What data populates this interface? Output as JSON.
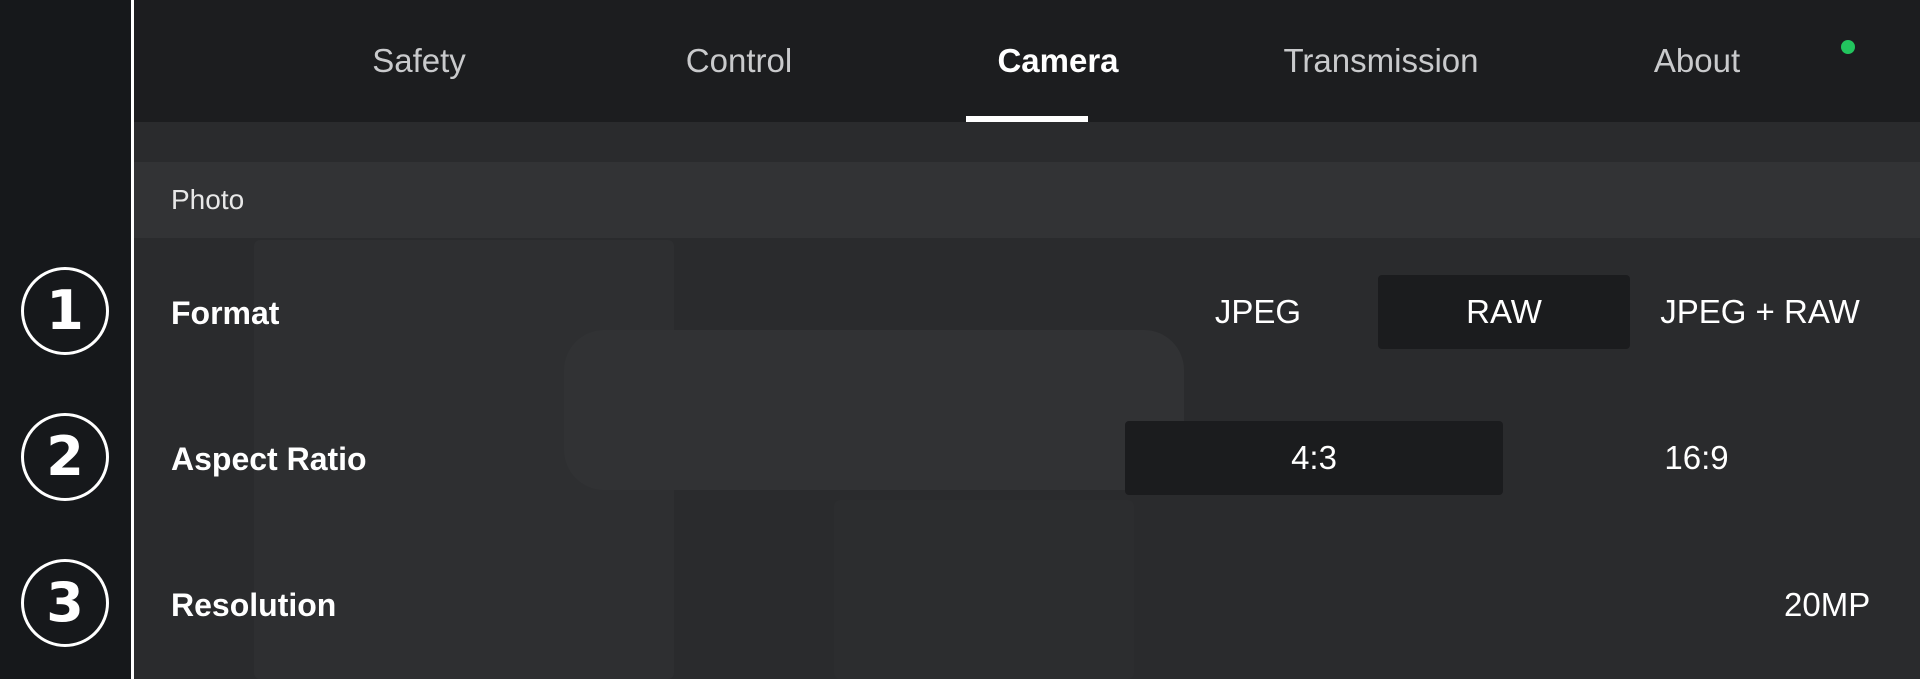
{
  "markers": [
    "1",
    "2",
    "3"
  ],
  "tabs": [
    {
      "label": "Safety",
      "active": false
    },
    {
      "label": "Control",
      "active": false
    },
    {
      "label": "Camera",
      "active": true
    },
    {
      "label": "Transmission",
      "active": false
    },
    {
      "label": "About",
      "active": false
    }
  ],
  "status": {
    "color": "#22c55e"
  },
  "section": {
    "title": "Photo"
  },
  "settings": {
    "format": {
      "label": "Format",
      "options": [
        "JPEG",
        "RAW",
        "JPEG + RAW"
      ],
      "selected": "RAW"
    },
    "aspect_ratio": {
      "label": "Aspect Ratio",
      "options": [
        "4:3",
        "16:9"
      ],
      "selected": "4:3"
    },
    "resolution": {
      "label": "Resolution",
      "value": "20MP"
    }
  }
}
